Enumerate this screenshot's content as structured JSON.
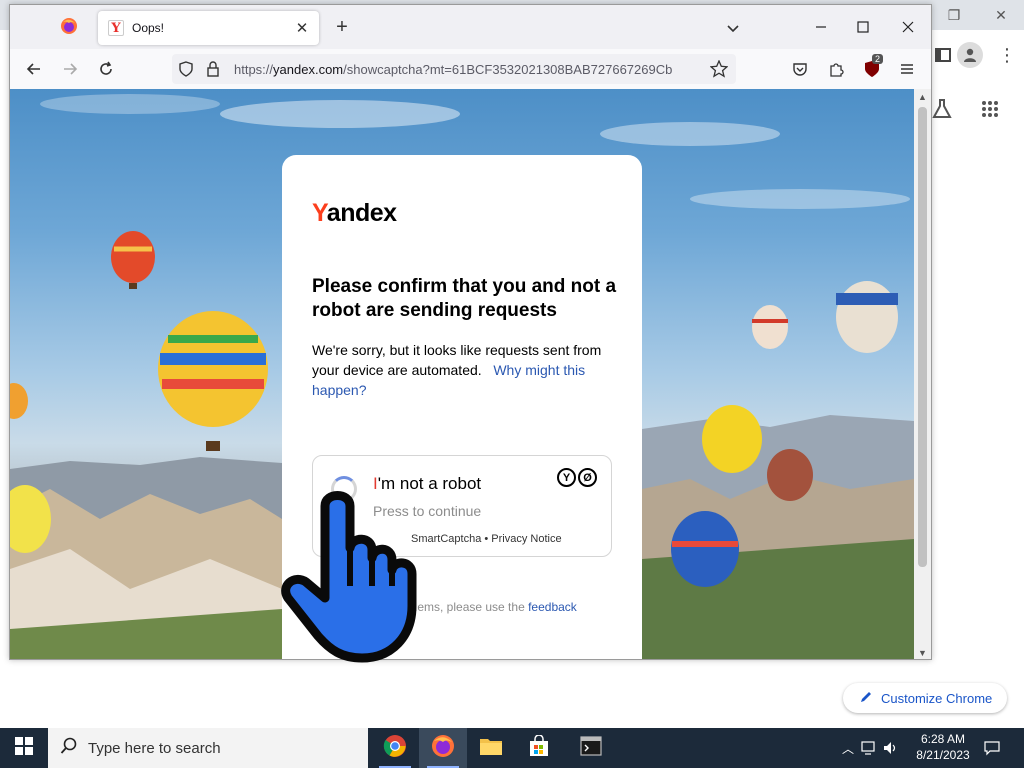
{
  "firefox": {
    "tab_title": "Oops!",
    "tab_favicon": "Y",
    "url_scheme": "https://",
    "url_host": "yandex.com",
    "url_path": "/showcaptcha?mt=61BCF3532021308BAB727667269Cb",
    "extension_badge": "2"
  },
  "page": {
    "brand_first": "Y",
    "brand_rest": "andex",
    "heading": "Please confirm that you and not a robot are sending requests",
    "paragraph": "We're sorry, but it looks like requests sent from your device are automated.",
    "why_link": "Why might this happen?",
    "captcha_label_first": "I",
    "captcha_label_rest": "'m not a robot",
    "captcha_sub": "Press to continue",
    "captcha_footer_brand": "SmartCaptcha",
    "captcha_footer_sep": "•",
    "captcha_footer_privacy": "Privacy Notice",
    "feedback_text": "blems, please use the",
    "feedback_link": "feedback"
  },
  "chrome": {
    "customize_label": "Customize Chrome"
  },
  "taskbar": {
    "search_placeholder": "Type here to search",
    "time": "6:28 AM",
    "date": "8/21/2023"
  },
  "colors": {
    "yandex_red": "#fc3f1d",
    "link_blue": "#2b58b1",
    "hand_blue": "#2a6fe8",
    "taskbar": "#1c2a3a"
  }
}
